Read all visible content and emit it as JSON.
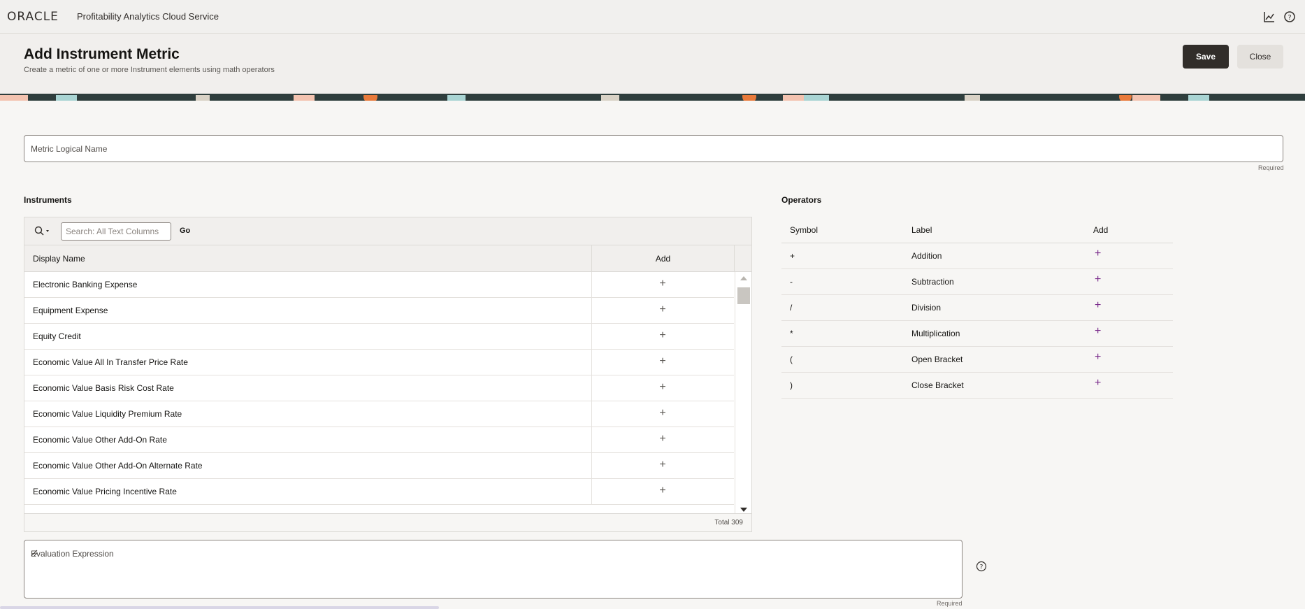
{
  "brand": {
    "logo": "ORACLE",
    "app_name": "Profitability Analytics Cloud Service"
  },
  "header_icons": [
    "analytics-chart-icon",
    "help-icon"
  ],
  "page": {
    "title": "Add Instrument Metric",
    "subtitle": "Create a metric of one or more Instrument elements using math operators",
    "save_label": "Save",
    "close_label": "Close"
  },
  "metric_name": {
    "placeholder": "Metric Logical Name",
    "required": "Required"
  },
  "instruments": {
    "label": "Instruments",
    "search_placeholder": "Search: All Text Columns",
    "go_label": "Go",
    "columns": [
      "Display Name",
      "Add"
    ],
    "rows": [
      "Electronic Banking Expense",
      "Equipment Expense",
      "Equity Credit",
      "Economic Value All In Transfer Price Rate",
      "Economic Value Basis Risk Cost Rate",
      "Economic Value Liquidity Premium Rate",
      "Economic Value Other Add-On Rate",
      "Economic Value Other Add-On Alternate Rate",
      "Economic Value Pricing Incentive Rate"
    ],
    "add_symbol": "+",
    "total": "Total 309"
  },
  "operators": {
    "label": "Operators",
    "columns": [
      "Symbol",
      "Label",
      "Add"
    ],
    "rows": [
      {
        "symbol": "+",
        "label": "Addition"
      },
      {
        "symbol": "-",
        "label": "Subtraction"
      },
      {
        "symbol": "/",
        "label": "Division"
      },
      {
        "symbol": "*",
        "label": "Multiplication"
      },
      {
        "symbol": "(",
        "label": "Open Bracket"
      },
      {
        "symbol": ")",
        "label": "Close Bracket"
      }
    ],
    "add_symbol": "+"
  },
  "expression": {
    "placeholder": "Evaluation Expression",
    "required": "Required"
  },
  "colors": {
    "primary_button": "#312d2a",
    "operator_plus": "#7b2d8c"
  }
}
